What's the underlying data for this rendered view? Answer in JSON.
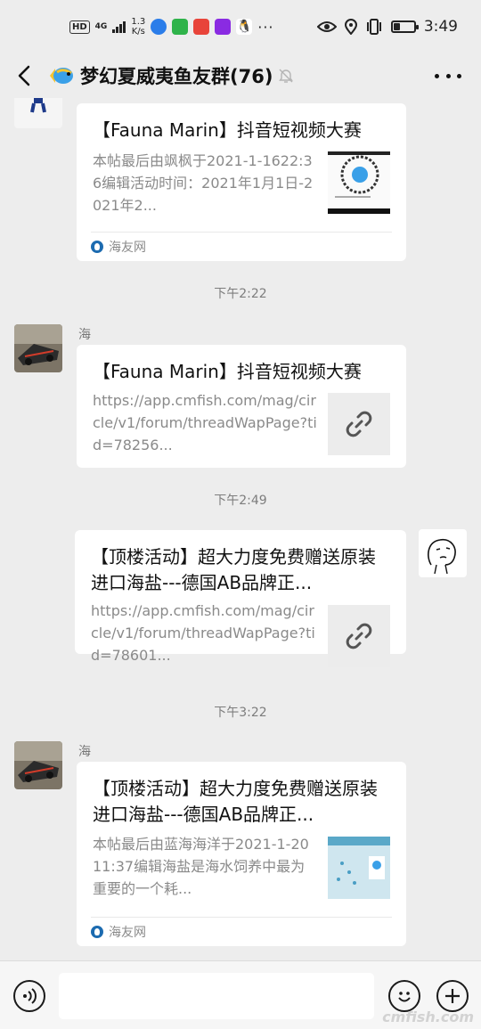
{
  "status_bar": {
    "hd": "HD",
    "network": "4G",
    "speed_value": "1.3",
    "speed_unit": "K/s",
    "more": "···",
    "time": "3:49",
    "battery_level": 0.3
  },
  "header": {
    "title": "梦幻夏威夷鱼友群(76)",
    "muted": true
  },
  "messages": [
    {
      "title": "【Fauna Marin】抖音短视频大赛",
      "desc": "本帖最后由飒枫于2021-1-1622:36编辑活动时间：2021年1月1日-2021年2...",
      "source": "海友网"
    },
    {
      "time": "下午2:22",
      "sender": "海",
      "title": "【Fauna Marin】抖音短视频大赛",
      "desc": "https://app.cmfish.com/mag/circle/v1/forum/threadWapPage?tid=78256..."
    },
    {
      "time": "下午2:49",
      "title": "【顶楼活动】超大力度免费赠送原装进口海盐---德国AB品牌正...",
      "desc": "https://app.cmfish.com/mag/circle/v1/forum/threadWapPage?tid=78601..."
    },
    {
      "time": "下午3:22",
      "sender": "海",
      "title": "【顶楼活动】超大力度免费赠送原装进口海盐---德国AB品牌正...",
      "desc": "本帖最后由蓝海海洋于2021-1-2011:37编辑海盐是海水饲养中最为重要的一个耗...",
      "source": "海友网"
    }
  ],
  "input_bar": {
    "placeholder": "",
    "watermark": "cmfish.com"
  },
  "colors": {
    "background": "#ededed",
    "card": "#ffffff",
    "muted_text": "#8a8a8a",
    "input_bar": "#f6f6f6"
  }
}
